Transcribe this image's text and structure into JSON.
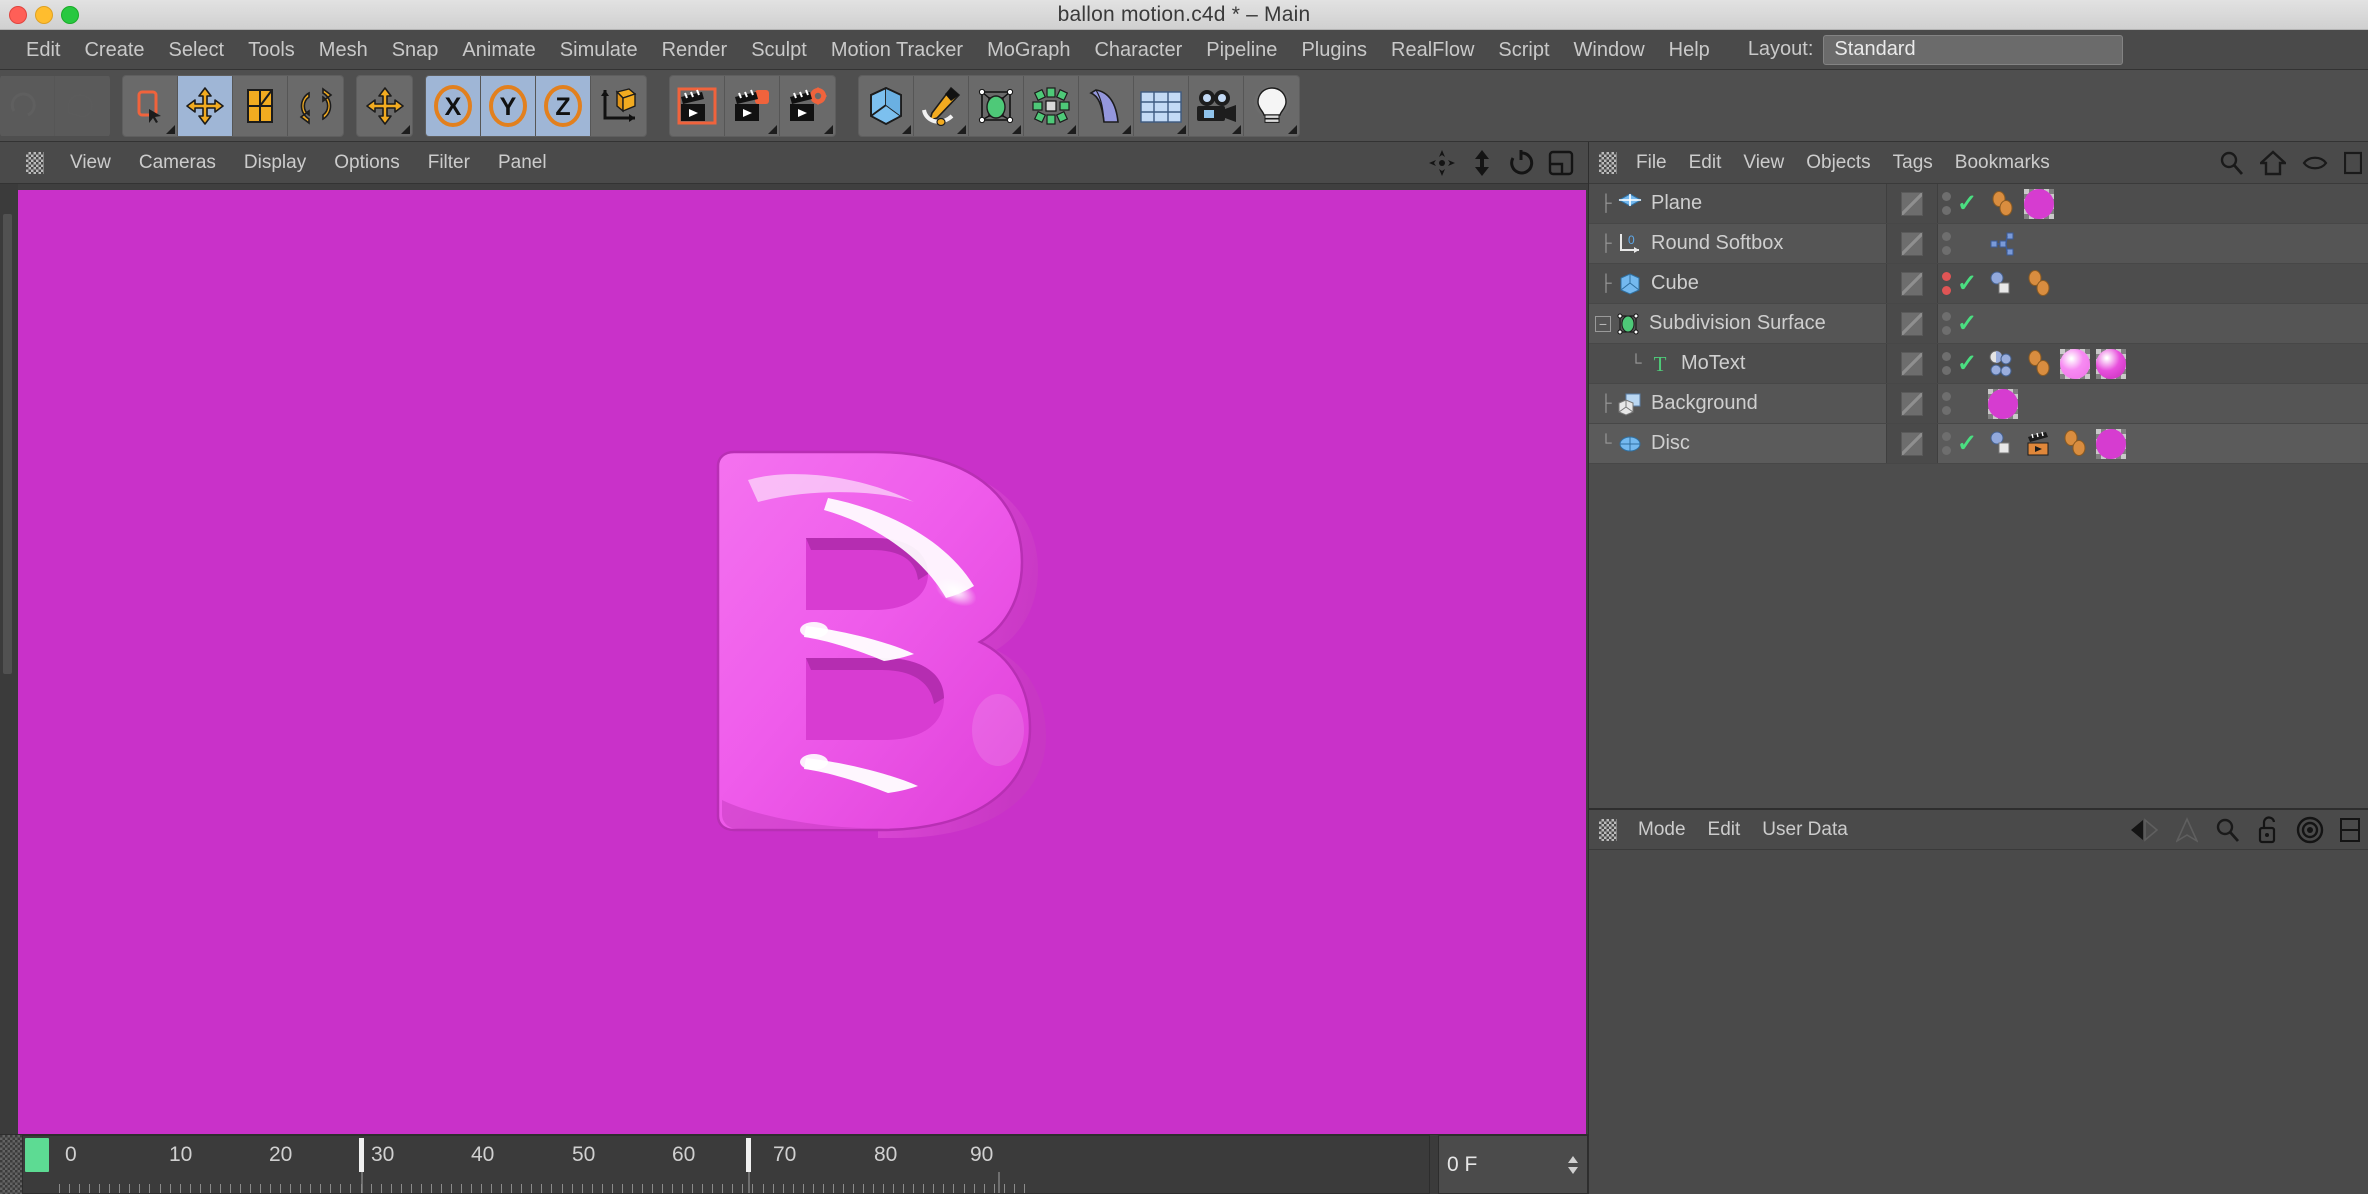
{
  "window": {
    "title": "ballon motion.c4d * – Main",
    "traffic_lights": [
      "close",
      "minimize",
      "zoom"
    ]
  },
  "menubar": {
    "items": [
      "Edit",
      "Create",
      "Select",
      "Tools",
      "Mesh",
      "Snap",
      "Animate",
      "Simulate",
      "Render",
      "Sculpt",
      "Motion Tracker",
      "MoGraph",
      "Character",
      "Pipeline",
      "Plugins",
      "RealFlow",
      "Script",
      "Window",
      "Help"
    ],
    "layout_label": "Layout:",
    "layout_value": "Standard"
  },
  "toolbar": {
    "groups": [
      {
        "name": "navigation",
        "buttons": [
          {
            "icon": "undo-icon",
            "state": "disabled"
          },
          {
            "icon": "redo-icon",
            "state": "disabled"
          }
        ]
      },
      {
        "name": "selection-transform",
        "buttons": [
          {
            "icon": "live-selection-icon",
            "state": "normal"
          },
          {
            "icon": "move-tool-icon",
            "state": "active"
          },
          {
            "icon": "scale-tool-icon",
            "state": "normal"
          },
          {
            "icon": "rotate-tool-icon",
            "state": "normal"
          }
        ]
      },
      {
        "name": "move-duplicate",
        "buttons": [
          {
            "icon": "move-axis-icon",
            "state": "normal"
          }
        ]
      },
      {
        "name": "axis-locks",
        "buttons": [
          {
            "icon": "lock-x-icon",
            "state": "active",
            "label": "X"
          },
          {
            "icon": "lock-y-icon",
            "state": "active",
            "label": "Y"
          },
          {
            "icon": "lock-z-icon",
            "state": "active",
            "label": "Z"
          },
          {
            "icon": "world-object-axis-icon",
            "state": "normal"
          }
        ]
      },
      {
        "name": "render",
        "buttons": [
          {
            "icon": "render-view-icon",
            "state": "normal"
          },
          {
            "icon": "render-to-picture-viewer-icon",
            "state": "normal"
          },
          {
            "icon": "render-settings-icon",
            "state": "normal"
          }
        ]
      },
      {
        "name": "create-objects",
        "buttons": [
          {
            "icon": "cube-primitive-icon",
            "state": "normal"
          },
          {
            "icon": "spline-pen-icon",
            "state": "normal"
          },
          {
            "icon": "subdivision-surface-icon",
            "state": "normal"
          },
          {
            "icon": "array-generator-icon",
            "state": "normal"
          },
          {
            "icon": "bend-deformer-icon",
            "state": "normal"
          },
          {
            "icon": "floor-environment-icon",
            "state": "normal"
          },
          {
            "icon": "camera-icon",
            "state": "normal"
          },
          {
            "icon": "light-icon",
            "state": "normal"
          }
        ]
      }
    ]
  },
  "viewport": {
    "menus": [
      "View",
      "Cameras",
      "Display",
      "Options",
      "Filter",
      "Panel"
    ],
    "corner_icons": [
      "pan-icon",
      "move-vertical-icon",
      "rotate-icon",
      "maximize-viewport-icon"
    ],
    "background_color": "#c931c9",
    "balloon_color": "#ea4fe6",
    "balloon_letter": "B"
  },
  "object_manager": {
    "menus": [
      "File",
      "Edit",
      "View",
      "Objects",
      "Tags",
      "Bookmarks"
    ],
    "header_icons": [
      "search-icon",
      "home-icon",
      "eye-icon",
      "layer-icon"
    ],
    "objects": [
      {
        "name": "Plane",
        "icon": "plane-object-icon",
        "indent": 0,
        "expander": "none",
        "visibility_dots": [
          "gray",
          "gray"
        ],
        "enabled_check": true,
        "tags": [
          "phong-tag",
          "material-magenta-tag"
        ]
      },
      {
        "name": "Round Softbox",
        "icon": "null-object-icon",
        "indent": 0,
        "expander": "none",
        "visibility_dots": [
          "gray",
          "gray"
        ],
        "enabled_check": false,
        "tags": [
          "xpresso-tag"
        ]
      },
      {
        "name": "Cube",
        "icon": "cube-object-icon",
        "indent": 0,
        "expander": "none",
        "visibility_dots": [
          "red",
          "red"
        ],
        "enabled_check": true,
        "tags": [
          "cloner-tag",
          "phong-tag"
        ]
      },
      {
        "name": "Subdivision Surface",
        "icon": "subdivision-object-icon",
        "indent": 0,
        "expander": "collapse",
        "visibility_dots": [
          "gray",
          "gray"
        ],
        "enabled_check": true,
        "tags": []
      },
      {
        "name": "MoText",
        "icon": "motext-object-icon",
        "indent": 1,
        "expander": "child",
        "visibility_dots": [
          "gray",
          "gray"
        ],
        "enabled_check": true,
        "tags": [
          "mograph-tag",
          "phong-tag",
          "material-pink-tag",
          "material-magenta-tag"
        ]
      },
      {
        "name": "Background",
        "icon": "background-object-icon",
        "indent": 0,
        "expander": "none",
        "visibility_dots": [
          "gray",
          "gray"
        ],
        "enabled_check": false,
        "tags": [
          "material-magenta-tag"
        ]
      },
      {
        "name": "Disc",
        "icon": "disc-object-icon",
        "indent": 0,
        "expander": "none",
        "visibility_dots": [
          "gray",
          "gray"
        ],
        "enabled_check": true,
        "tags": [
          "cloner-tag",
          "keyframe-tag",
          "phong-tag",
          "material-magenta-tag"
        ]
      }
    ]
  },
  "attribute_manager": {
    "menus": [
      "Mode",
      "Edit",
      "User Data"
    ],
    "nav_icons": [
      "back-arrow-icon",
      "forward-arrow-icon",
      "up-arrow-icon"
    ],
    "header_icons": [
      "search-icon",
      "unlock-icon",
      "target-icon",
      "grid-icon"
    ]
  },
  "timeline": {
    "labels": [
      "0",
      "10",
      "20",
      "30",
      "40",
      "50",
      "60",
      "70",
      "80",
      "90"
    ],
    "label_positions": [
      0,
      11.1,
      22.2,
      33.3,
      44.4,
      55.5,
      66.6,
      77.7,
      88.8,
      99
    ],
    "markers": [
      33.3,
      72.0
    ],
    "current_frame_start": 0,
    "frame_field_value": "0 F",
    "frame_field_unit": "F"
  }
}
